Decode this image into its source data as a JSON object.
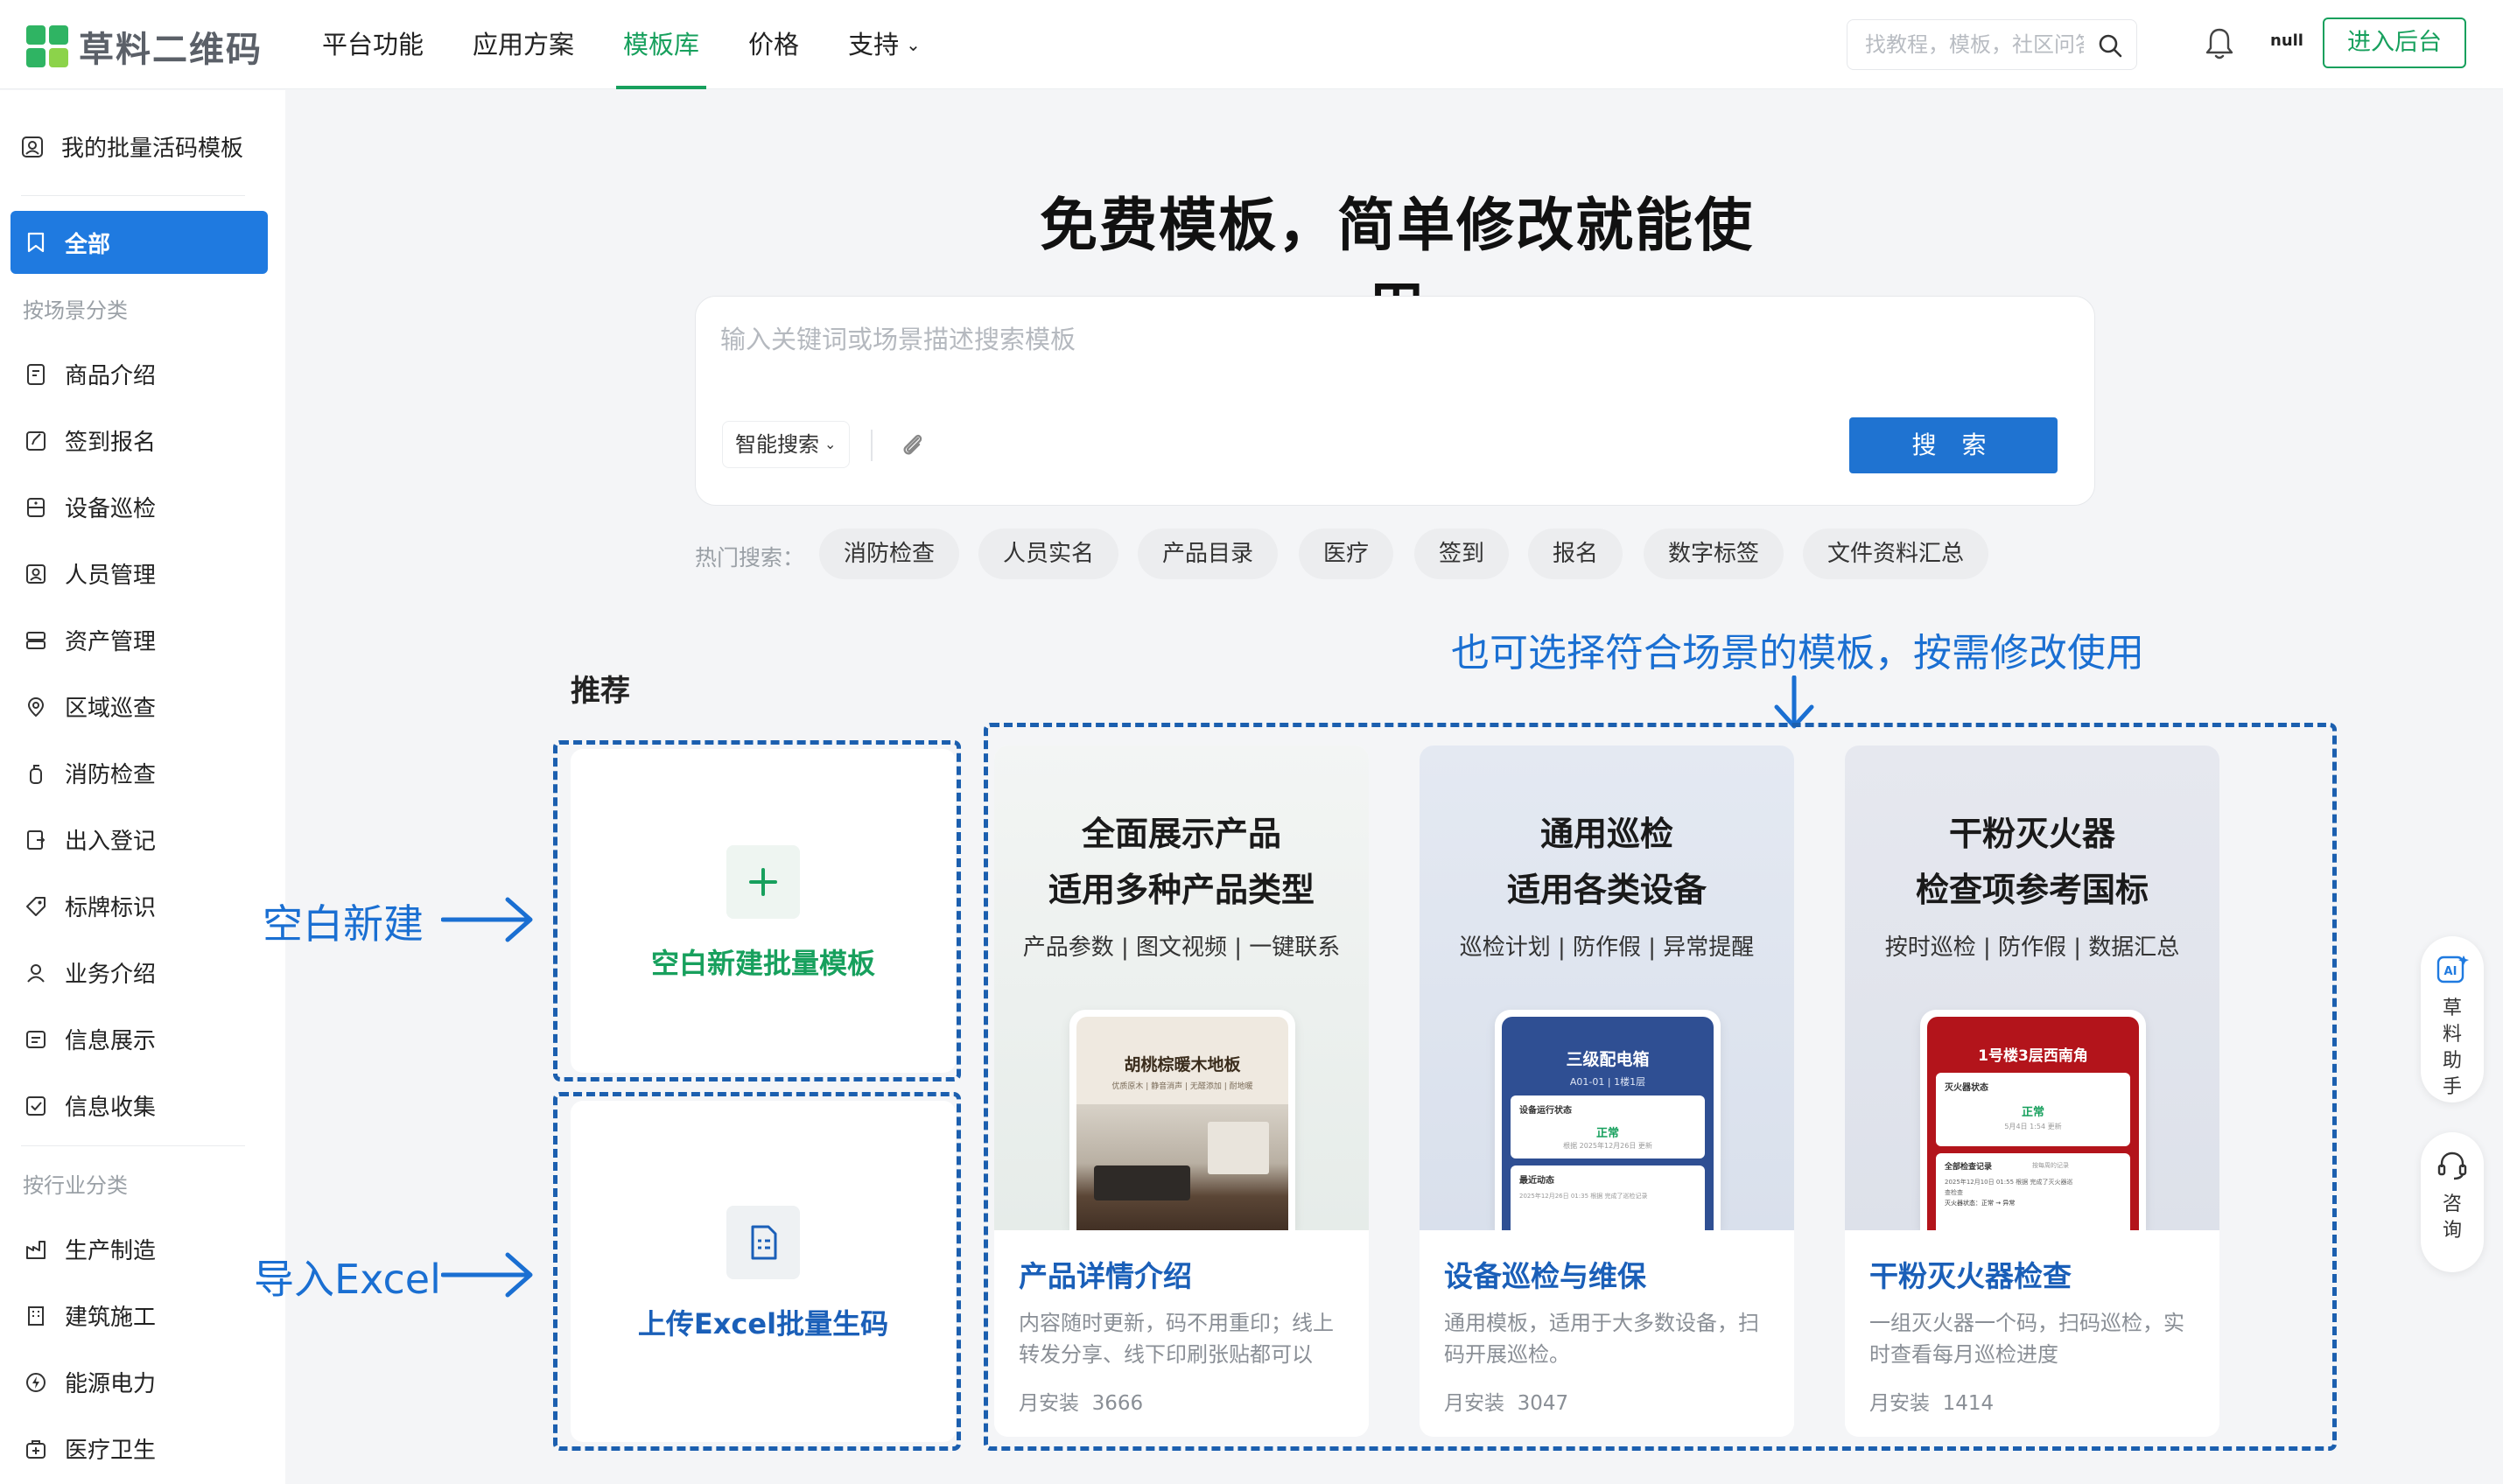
{
  "brand": {
    "name": "草料二维码",
    "colors": {
      "primary_green": "#17a05d",
      "primary_blue": "#1f7ae0",
      "annotation_blue": "#1a6fd2"
    }
  },
  "nav": {
    "items": [
      {
        "label": "平台功能",
        "active": false
      },
      {
        "label": "应用方案",
        "active": false
      },
      {
        "label": "模板库",
        "active": true
      },
      {
        "label": "价格",
        "active": false
      },
      {
        "label": "支持",
        "active": false,
        "has_dropdown": true
      }
    ],
    "search_placeholder": "找教程，模板，社区问答",
    "user_name": "null",
    "enter_button": "进入后台"
  },
  "sidebar": {
    "my_templates": "我的批量活码模板",
    "all_label": "全部",
    "scene_section": "按场景分类",
    "scene_items": [
      "商品介绍",
      "签到报名",
      "设备巡检",
      "人员管理",
      "资产管理",
      "区域巡查",
      "消防检查",
      "出入登记",
      "标牌标识",
      "业务介绍",
      "信息展示",
      "信息收集"
    ],
    "industry_section": "按行业分类",
    "industry_items": [
      "生产制造",
      "建筑施工",
      "能源电力",
      "医疗卫生"
    ]
  },
  "main": {
    "hero_title": "免费模板，简单修改就能使用",
    "search_placeholder": "输入关键词或场景描述搜索模板",
    "smart_search": "智能搜索",
    "search_button": "搜 索",
    "hot_label": "热门搜索：",
    "hot_tags": [
      "消防检查",
      "人员实名",
      "产品目录",
      "医疗",
      "签到",
      "报名",
      "数字标签",
      "文件资料汇总"
    ],
    "recommend_title": "推荐",
    "annotations": {
      "top": "也可选择符合场景的模板，按需修改使用",
      "blank": "空白新建",
      "excel": "导入Excel"
    },
    "blank_card_label": "空白新建批量模板",
    "excel_card_label": "上传Excel批量生码",
    "templates": [
      {
        "headline1": "全面展示产品",
        "headline2": "适用多种产品类型",
        "tags": "产品参数 | 图文视频 | 一键联系",
        "preview_title": "胡桃棕暖木地板",
        "preview_sub": "优质原木 | 静音消声 | 无醛添加 | 耐地暖",
        "name": "产品详情介绍",
        "desc": "内容随时更新，码不用重印；线上转发分享、线下印刷张贴都可以",
        "installs_label": "月安装",
        "installs": "3666"
      },
      {
        "headline1": "通用巡检",
        "headline2": "适用各类设备",
        "tags": "巡检计划 | 防作假 | 异常提醒",
        "preview_title": "三级配电箱",
        "preview_sub": "A01-01 | 1楼1层",
        "preview_status_label": "设备运行状态",
        "preview_status": "正常",
        "preview_status_note": "根据 2025年12月26日 更新",
        "preview_section": "最近动态",
        "preview_section_note": "2025年12月26日 01:35 根据 完成了巡检记录",
        "name": "设备巡检与维保",
        "desc": "通用模板，适用于大多数设备，扫码开展巡检。",
        "installs_label": "月安装",
        "installs": "3047"
      },
      {
        "headline1": "干粉灭火器",
        "headline2": "检查项参考国标",
        "tags": "按时巡检 | 防作假 | 数据汇总",
        "preview_title": "1号楼3层西南角",
        "preview_status_label": "灭火器状态",
        "preview_status": "正常",
        "preview_status_note": "5月4日 1:54 更新",
        "preview_section": "全部检查记录",
        "preview_section_note": "按每周的记录",
        "preview_row1": "2025年12月10日 01:55 根据 完成了灭火器巡",
        "preview_row2": "查检查",
        "preview_row3": "灭火器状态：正常 → 异常",
        "name": "干粉灭火器检查",
        "desc": "一组灭火器一个码，扫码巡检，实时查看每月巡检进度",
        "installs_label": "月安装",
        "installs": "1414"
      }
    ]
  },
  "floating": {
    "assistant": "草料助手",
    "consult": "咨询"
  }
}
